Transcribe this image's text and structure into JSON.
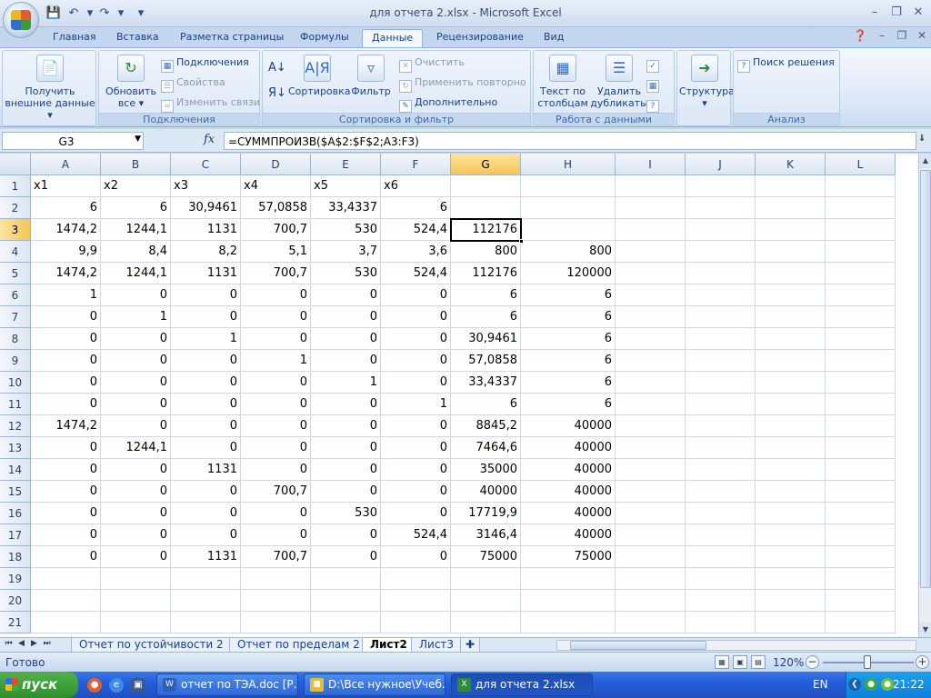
{
  "window": {
    "title": "для отчета 2.xlsx - Microsoft Excel"
  },
  "ribbon": {
    "tabs": [
      "Главная",
      "Вставка",
      "Разметка страницы",
      "Формулы",
      "Данные",
      "Рецензирование",
      "Вид"
    ],
    "active_tab": "Данные",
    "groups": {
      "external": {
        "btn_line1": "Получить",
        "btn_line2": "внешние данные ▾"
      },
      "connections": {
        "label": "Подключения",
        "refresh_line1": "Обновить",
        "refresh_line2": "все ▾",
        "connections": "Подключения",
        "properties": "Свойства",
        "edit_links": "Изменить связи"
      },
      "sort": {
        "label": "Сортировка и фильтр",
        "sort": "Сортировка",
        "filter": "Фильтр",
        "clear": "Очистить",
        "reapply": "Применить повторно",
        "advanced": "Дополнительно"
      },
      "data_tools": {
        "label": "Работа с данными",
        "text_to_cols_line1": "Текст по",
        "text_to_cols_line2": "столбцам",
        "dupes_line1": "Удалить",
        "dupes_line2": "дубликаты"
      },
      "outline": {
        "btn_line1": "Структура",
        "btn_line2": "▾"
      },
      "analysis": {
        "label": "Анализ",
        "solver": "Поиск решения"
      }
    }
  },
  "formula_bar": {
    "name_box": "G3",
    "fx": "fx",
    "formula": "=СУММПРОИЗВ($A$2:$F$2;A3:F3)"
  },
  "grid": {
    "columns": [
      "A",
      "B",
      "C",
      "D",
      "E",
      "F",
      "G",
      "H",
      "I",
      "J",
      "K",
      "L"
    ],
    "selected_column": "G",
    "selected_row": "3",
    "rows": [
      {
        "n": "1",
        "cells": [
          "x1",
          "x2",
          "x3",
          "x4",
          "x5",
          "x6",
          "",
          "",
          "",
          "",
          "",
          ""
        ]
      },
      {
        "n": "2",
        "cells": [
          "6",
          "6",
          "30,9461",
          "57,0858",
          "33,4337",
          "6",
          "",
          "",
          "",
          "",
          "",
          ""
        ]
      },
      {
        "n": "3",
        "cells": [
          "1474,2",
          "1244,1",
          "1131",
          "700,7",
          "530",
          "524,4",
          "112176",
          "",
          "",
          "",
          "",
          ""
        ]
      },
      {
        "n": "4",
        "cells": [
          "9,9",
          "8,4",
          "8,2",
          "5,1",
          "3,7",
          "3,6",
          "800",
          "800",
          "",
          "",
          "",
          ""
        ]
      },
      {
        "n": "5",
        "cells": [
          "1474,2",
          "1244,1",
          "1131",
          "700,7",
          "530",
          "524,4",
          "112176",
          "120000",
          "",
          "",
          "",
          ""
        ]
      },
      {
        "n": "6",
        "cells": [
          "1",
          "0",
          "0",
          "0",
          "0",
          "0",
          "6",
          "6",
          "",
          "",
          "",
          ""
        ]
      },
      {
        "n": "7",
        "cells": [
          "0",
          "1",
          "0",
          "0",
          "0",
          "0",
          "6",
          "6",
          "",
          "",
          "",
          ""
        ]
      },
      {
        "n": "8",
        "cells": [
          "0",
          "0",
          "1",
          "0",
          "0",
          "0",
          "30,9461",
          "6",
          "",
          "",
          "",
          ""
        ]
      },
      {
        "n": "9",
        "cells": [
          "0",
          "0",
          "0",
          "1",
          "0",
          "0",
          "57,0858",
          "6",
          "",
          "",
          "",
          ""
        ]
      },
      {
        "n": "10",
        "cells": [
          "0",
          "0",
          "0",
          "0",
          "1",
          "0",
          "33,4337",
          "6",
          "",
          "",
          "",
          ""
        ]
      },
      {
        "n": "11",
        "cells": [
          "0",
          "0",
          "0",
          "0",
          "0",
          "1",
          "6",
          "6",
          "",
          "",
          "",
          ""
        ]
      },
      {
        "n": "12",
        "cells": [
          "1474,2",
          "0",
          "0",
          "0",
          "0",
          "0",
          "8845,2",
          "40000",
          "",
          "",
          "",
          ""
        ]
      },
      {
        "n": "13",
        "cells": [
          "0",
          "1244,1",
          "0",
          "0",
          "0",
          "0",
          "7464,6",
          "40000",
          "",
          "",
          "",
          ""
        ]
      },
      {
        "n": "14",
        "cells": [
          "0",
          "0",
          "1131",
          "0",
          "0",
          "0",
          "35000",
          "40000",
          "",
          "",
          "",
          ""
        ]
      },
      {
        "n": "15",
        "cells": [
          "0",
          "0",
          "0",
          "700,7",
          "0",
          "0",
          "40000",
          "40000",
          "",
          "",
          "",
          ""
        ]
      },
      {
        "n": "16",
        "cells": [
          "0",
          "0",
          "0",
          "0",
          "530",
          "0",
          "17719,9",
          "40000",
          "",
          "",
          "",
          ""
        ]
      },
      {
        "n": "17",
        "cells": [
          "0",
          "0",
          "0",
          "0",
          "0",
          "524,4",
          "3146,4",
          "40000",
          "",
          "",
          "",
          ""
        ]
      },
      {
        "n": "18",
        "cells": [
          "0",
          "0",
          "1131",
          "700,7",
          "0",
          "0",
          "75000",
          "75000",
          "",
          "",
          "",
          ""
        ]
      },
      {
        "n": "19",
        "cells": [
          "",
          "",
          "",
          "",
          "",
          "",
          "",
          "",
          "",
          "",
          "",
          ""
        ]
      },
      {
        "n": "20",
        "cells": [
          "",
          "",
          "",
          "",
          "",
          "",
          "",
          "",
          "",
          "",
          "",
          ""
        ]
      },
      {
        "n": "21",
        "cells": [
          "",
          "",
          "",
          "",
          "",
          "",
          "",
          "",
          "",
          "",
          "",
          ""
        ]
      }
    ]
  },
  "sheets": {
    "tabs": [
      "Отчет по устойчивости 2",
      "Отчет по пределам 2",
      "Лист2",
      "Лист3"
    ],
    "active": "Лист2"
  },
  "status": {
    "text": "Готово",
    "zoom": "120%",
    "zoom_level_percent": 120
  },
  "taskbar": {
    "start": "пуск",
    "buttons": [
      "отчет по ТЭА.doc [Р...",
      "D:\\Все нужное\\Учеб...",
      "для отчета 2.xlsx"
    ],
    "active_button": "для отчета 2.xlsx",
    "lang": "EN",
    "clock": "21:22"
  }
}
